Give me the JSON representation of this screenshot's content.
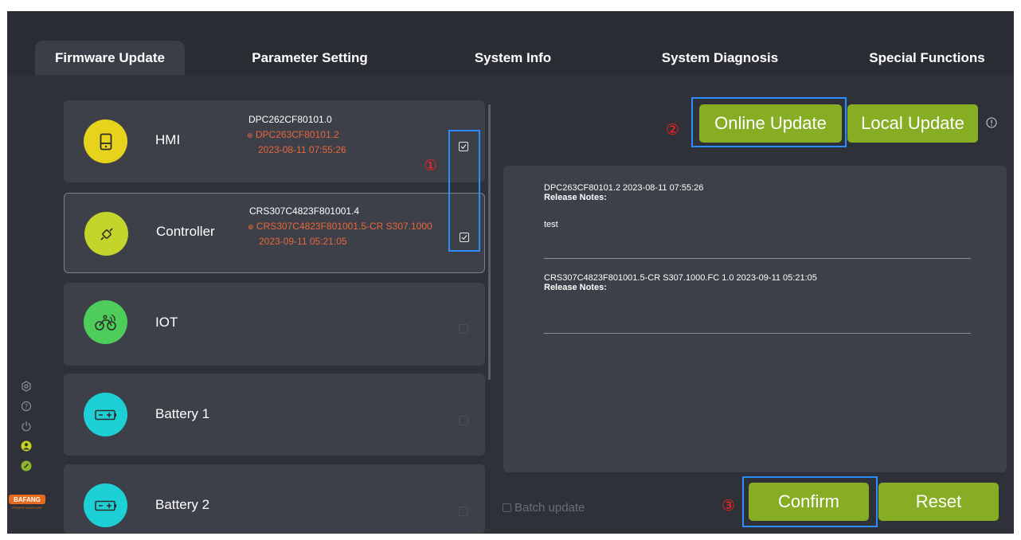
{
  "tabs": [
    {
      "label": "Firmware Update",
      "active": true
    },
    {
      "label": "Parameter Setting",
      "active": false
    },
    {
      "label": "System Info",
      "active": false
    },
    {
      "label": "System Diagnosis",
      "active": false
    },
    {
      "label": "Special Functions",
      "active": false
    }
  ],
  "devices": [
    {
      "name": "HMI",
      "icon": "display-icon",
      "color": "#e7d21c",
      "current_version": "DPC262CF80101.0",
      "new_version": "DPC263CF80101.2",
      "date": "2023-08-11 07:55:26",
      "checked": true
    },
    {
      "name": "Controller",
      "icon": "connector-icon",
      "color": "#c4d42a",
      "current_version": "CRS307C4823F801001.4",
      "new_version": "CRS307C4823F801001.5-CR S307.1000",
      "date": "2023-09-11 05:21:05",
      "checked": true
    },
    {
      "name": "IOT",
      "icon": "bike-wireless-icon",
      "color": "#4fcd5a",
      "checked": false
    },
    {
      "name": "Battery 1",
      "icon": "battery-icon",
      "color": "#1cd0d6",
      "checked": false
    },
    {
      "name": "Battery 2",
      "icon": "battery-icon",
      "color": "#1cd0d6",
      "checked": false
    }
  ],
  "buttons": {
    "online_update": "Online Update",
    "local_update": "Local Update",
    "confirm": "Confirm",
    "reset": "Reset"
  },
  "release_notes": [
    {
      "title": "DPC263CF80101.2 2023-08-11 07:55:26",
      "label": "Release Notes:",
      "body": "test"
    },
    {
      "title": "CRS307C4823F801001.5-CR S307.1000.FC 1.0 2023-09-11 05:21:05",
      "label": "Release Notes:",
      "body": ""
    }
  ],
  "batch_update": {
    "label": "Batch update",
    "checked": false
  },
  "annotations": [
    "①",
    "②",
    "③"
  ],
  "sidebar": {
    "icons": [
      "settings-icon",
      "help-icon",
      "power-icon",
      "user-icon",
      "link-icon"
    ],
    "logo": "BAFANG",
    "logo_tagline": "POWER YOUR LIFE"
  },
  "colors": {
    "accent_green": "#86ad24",
    "new_version_orange": "#e8663a",
    "annotation_blue": "#2a8cff",
    "annotation_red": "#ff2020"
  }
}
